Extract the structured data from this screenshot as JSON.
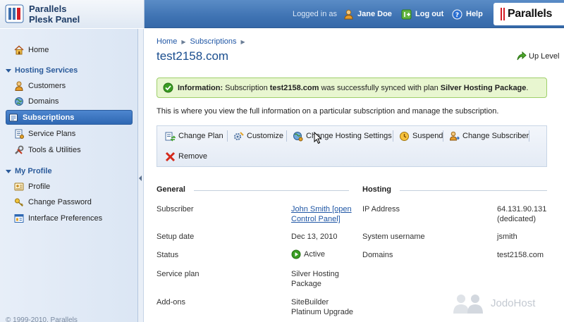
{
  "header": {
    "product_line1": "Parallels",
    "product_line2": "Plesk Panel",
    "logged_in_as": "Logged in as",
    "user_name": "Jane Doe",
    "logout_label": "Log out",
    "help_label": "Help",
    "brand": "Parallels"
  },
  "sidebar": {
    "home": "Home",
    "hosting_services": "Hosting Services",
    "customers": "Customers",
    "domains": "Domains",
    "subscriptions": "Subscriptions",
    "service_plans": "Service Plans",
    "tools_utilities": "Tools & Utilities",
    "my_profile": "My Profile",
    "profile": "Profile",
    "change_password": "Change Password",
    "interface_preferences": "Interface Preferences",
    "footer": "© 1999-2010, Parallels"
  },
  "breadcrumb": {
    "home": "Home",
    "subscriptions": "Subscriptions"
  },
  "page": {
    "title": "test2158.com",
    "up_level": "Up Level",
    "description": "This is where you view the full information on a particular subscription and manage the subscription."
  },
  "message": {
    "label": "Information:",
    "text1": "Subscription",
    "domain": "test2158.com",
    "text2": "was successfully synced with plan",
    "plan": "Silver Hosting Package",
    "text3": "."
  },
  "toolbar": {
    "change_plan": "Change Plan",
    "customize": "Customize",
    "change_hosting_settings": "Change Hosting Settings",
    "suspend": "Suspend",
    "change_subscriber": "Change Subscriber",
    "remove": "Remove"
  },
  "general": {
    "title": "General",
    "subscriber_label": "Subscriber",
    "subscriber_value_line1": "John Smith [open",
    "subscriber_value_line2": "Control Panel]",
    "setup_date_label": "Setup date",
    "setup_date_value": "Dec 13, 2010",
    "status_label": "Status",
    "status_value": "Active",
    "service_plan_label": "Service plan",
    "service_plan_line1": "Silver Hosting",
    "service_plan_line2": "Package",
    "addons_label": "Add-ons",
    "addons_line1": "SiteBuilder",
    "addons_line2": "Platinum Upgrade"
  },
  "hosting": {
    "title": "Hosting",
    "ip_label": "IP Address",
    "ip_value": "64.131.90.131",
    "ip_note": "(dedicated)",
    "sysuser_label": "System username",
    "sysuser_value": "jsmith",
    "domains_label": "Domains",
    "domains_value": "test2158.com"
  },
  "watermark": "JodoHost",
  "colors": {
    "accent": "#2f68b3",
    "success_bg": "#e8f6d0",
    "brand_red": "#d31b24"
  }
}
